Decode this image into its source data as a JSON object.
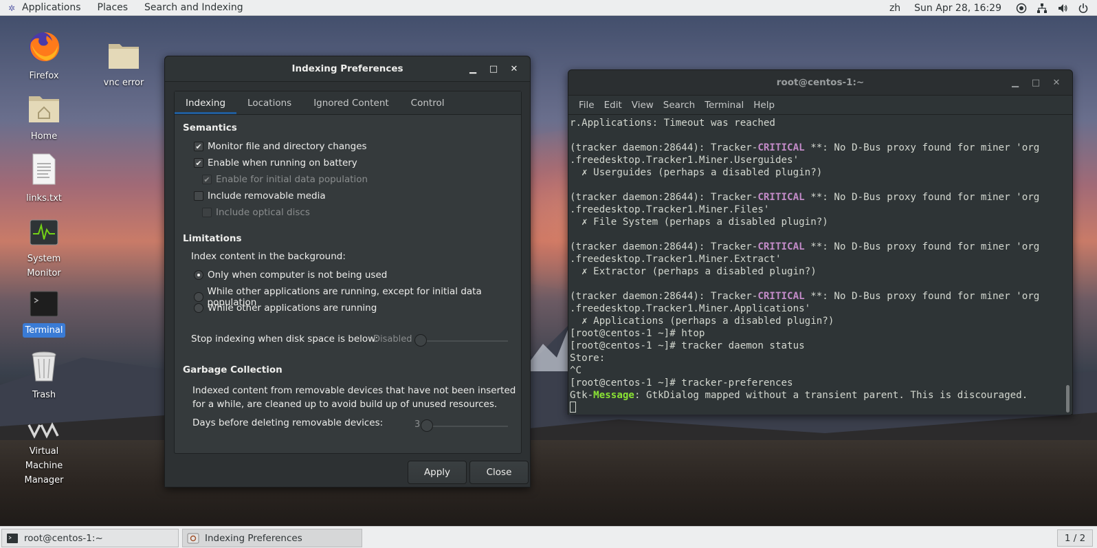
{
  "topbar": {
    "applications": "Applications",
    "places": "Places",
    "search_indexing": "Search and Indexing",
    "input_method": "zh",
    "clock": "Sun Apr 28, 16:29"
  },
  "desktop": {
    "firefox": "Firefox",
    "vnc_error": "vnc error",
    "home": "Home",
    "links": "links.txt",
    "system_monitor_1": "System",
    "system_monitor_2": "Monitor",
    "terminal": "Terminal",
    "trash": "Trash",
    "vmm_1": "Virtual",
    "vmm_2": "Machine",
    "vmm_3": "Manager"
  },
  "dialog": {
    "title": "Indexing Preferences",
    "tabs": [
      "Indexing",
      "Locations",
      "Ignored Content",
      "Control"
    ],
    "semantics": {
      "heading": "Semantics",
      "monitor": "Monitor file and directory changes",
      "battery": "Enable when running on battery",
      "initial": "Enable for initial data population",
      "removable": "Include removable media",
      "optical": "Include optical discs"
    },
    "limitations": {
      "heading": "Limitations",
      "index_bg": "Index content in the background:",
      "opt1": "Only when computer is not being used",
      "opt2": "While other applications are running, except for initial data population",
      "opt3": "While other applications are running",
      "stop_label": "Stop indexing when disk space is below:",
      "stop_value": "Disabled"
    },
    "garbage": {
      "heading": "Garbage Collection",
      "desc1": "Indexed content from removable devices that have not been inserted",
      "desc2": "for a while, are cleaned up to avoid build up of unused resources.",
      "days_label": "Days before deleting removable devices:",
      "days_value": "3"
    },
    "apply": "Apply",
    "close": "Close"
  },
  "terminal": {
    "title": "root@centos-1:~",
    "menu": [
      "File",
      "Edit",
      "View",
      "Search",
      "Terminal",
      "Help"
    ],
    "lines": {
      "l1": "r.Applications: Timeout was reached",
      "a_pre": "(tracker daemon:28644): Tracker-",
      "crit": "CRITICAL",
      "a_post": " **: No D-Bus proxy found for miner 'org",
      "userguides_2": ".freedesktop.Tracker1.Miner.Userguides'",
      "userguides_3": "  ✗ Userguides (perhaps a disabled plugin?)",
      "files_2": ".freedesktop.Tracker1.Miner.Files'",
      "files_3": "  ✗ File System (perhaps a disabled plugin?)",
      "extract_2": ".freedesktop.Tracker1.Miner.Extract'",
      "extract_3": "  ✗ Extractor (perhaps a disabled plugin?)",
      "apps_2": ".freedesktop.Tracker1.Miner.Applications'",
      "apps_3": "  ✗ Applications (perhaps a disabled plugin?)",
      "htop": "[root@centos-1 ~]# htop",
      "status": "[root@centos-1 ~]# tracker daemon status",
      "store": "Store:",
      "ctrlc": "^C",
      "prefs": "[root@centos-1 ~]# tracker-preferences",
      "gtk_pre": "Gtk-",
      "gtk_msg": "Message",
      "gtk_post": ": GtkDialog mapped without a transient parent. This is discouraged."
    }
  },
  "taskbar": {
    "terminal_task": "root@centos-1:~",
    "indexing_task": "Indexing Preferences",
    "workspace": "1 / 2"
  }
}
